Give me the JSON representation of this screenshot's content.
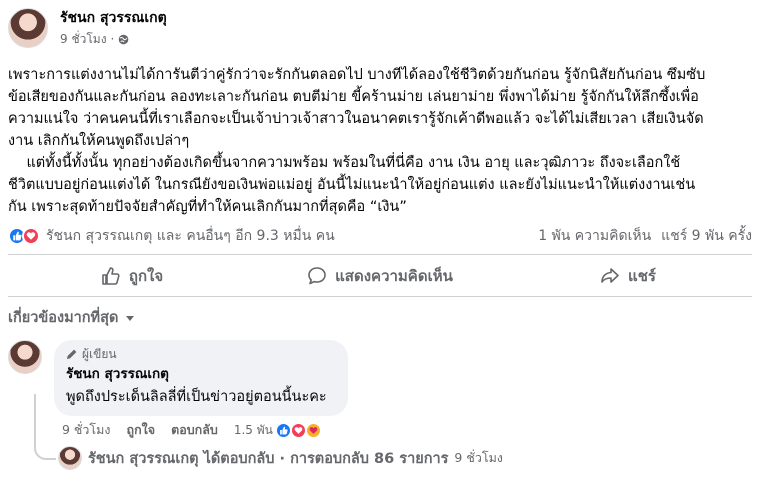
{
  "post": {
    "author": "รัชนก สุวรรณเกตุ",
    "time": "9 ชั่วโมง",
    "privacy_icon": "globe-icon",
    "body_lines": [
      "เพราะการแต่งงานไม่ได้การันตีว่าคู่รักว่าจะรักกันตลอดไป บางทีได้ลองใช้ชีวิตด้วยกันก่อน รู้จักนิสัยกันก่อน ซึมซับ",
      "ข้อเสียของกันและกันก่อน ลองทะเลาะกันก่อน ตบตีม่าย ขี้คร้านม่าย เล่นยาม่าย พึ่งพาได้ม่าย รู้จักกันให้ลึกซึ้งเพื่อ",
      "ความแน่ใจ ว่าคนคนนี้ที่เราเลือกจะเป็นเจ้าบ่าวเจ้าสาวในอนาคตเรารู้จักเค้าดีพอแล้ว จะได้ไม่เสียเวลา เสียเงินจัด",
      "งาน เลิกกันให้คนพูดถึงเปล่าๆ",
      "    แต่ทั้งนี้ทั้งนั้น ทุกอย่างต้องเกิดขึ้นจากความพร้อม พร้อมในที่นี่คือ งาน เงิน อายุ และวุฒิภาวะ ถึงจะเลือกใช้",
      "ชีวิตแบบอยู่ก่อนแต่งได้ ในกรณียังขอเงินพ่อแม่อยู่ อันนี้ไม่แนะนำให้อยู่ก่อนแต่ง และยังไม่แนะนำให้แต่งงานเช่น",
      "กัน เพราะสุดท้ายปัจจัยสำคัญที่ทำให้คนเลิกกันมากที่สุดคือ “เงิน”"
    ]
  },
  "reactions": {
    "summary": "รัชนก สุวรรณเกตุ และ คนอื่นๆ อีก 9.3 หมื่น คน",
    "comments_count": "1 พัน ความคิดเห็น",
    "shares_count": "แชร์ 9 พัน ครั้ง"
  },
  "actions": {
    "like": "ถูกใจ",
    "comment": "แสดงความคิดเห็น",
    "share": "แชร์"
  },
  "sort": {
    "label": "เกี่ยวข้องมากที่สุด"
  },
  "comment": {
    "badge": "ผู้เขียน",
    "author": "รัชนก สุวรรณเกตุ",
    "text": "พูดถึงประเด็นลิลลี่ที่เป็นข่าวอยู่ตอนนี้นะคะ",
    "time": "9 ชั่วโมง",
    "like_label": "ถูกใจ",
    "reply_label": "ตอบกลับ",
    "reaction_count": "1.5 พัน"
  },
  "reply_summary": {
    "text": "รัชนก สุวรรณเกตุ ได้ตอบกลับ · การตอบกลับ 86 รายการ",
    "time": "9 ชั่วโมง"
  },
  "colors": {
    "like_blue": "#1877f2",
    "love_red": "#f33e58",
    "care_yellow": "#f7b125",
    "muted_text": "#65676b"
  }
}
